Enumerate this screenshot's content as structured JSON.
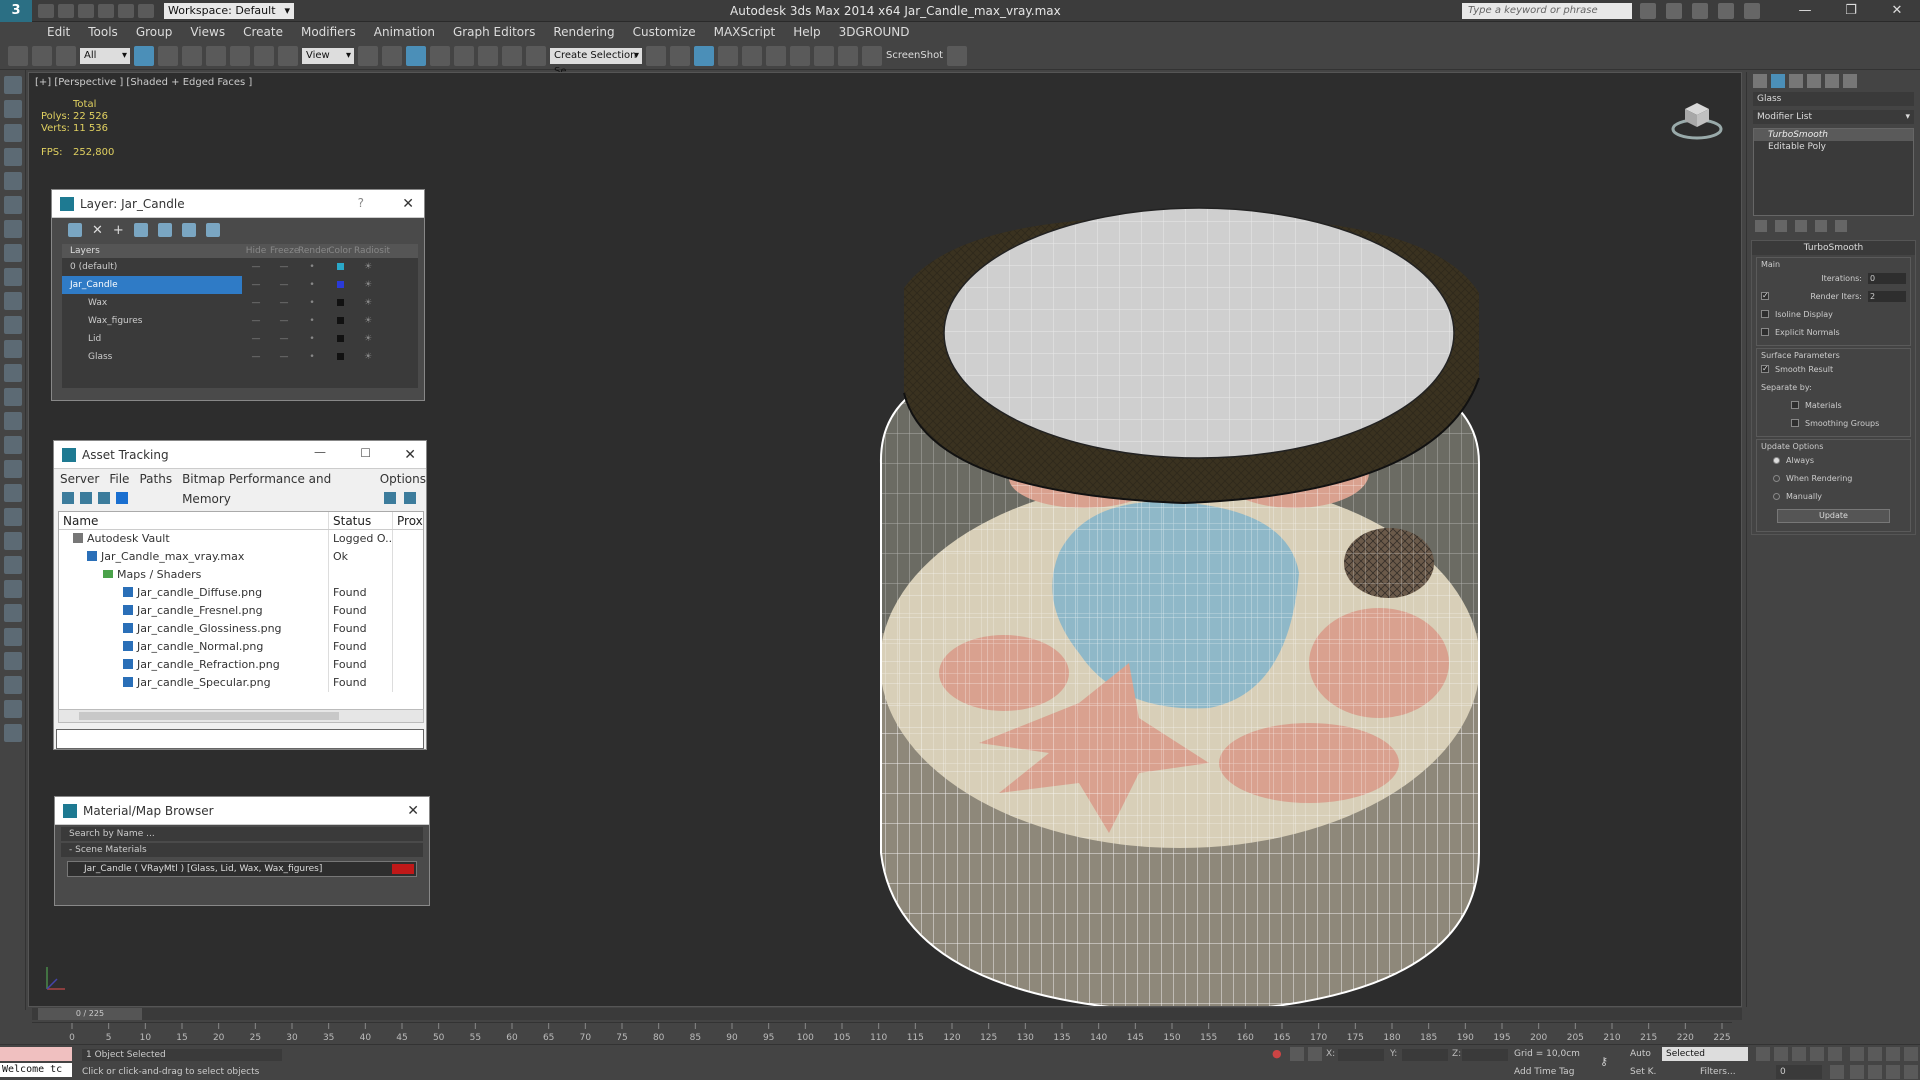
{
  "app": {
    "title": "Autodesk 3ds Max  2014 x64    Jar_Candle_max_vray.max",
    "logo": "3",
    "workspace": "Workspace: Default",
    "search_placeholder": "Type a keyword or phrase"
  },
  "menu": [
    "Edit",
    "Tools",
    "Group",
    "Views",
    "Create",
    "Modifiers",
    "Animation",
    "Graph Editors",
    "Rendering",
    "Customize",
    "MAXScript",
    "Help",
    "3DGROUND"
  ],
  "toolbar": {
    "filter": "All",
    "ref_coord": "View",
    "selection_set": "Create Selection Se",
    "screenshot": "ScreenShot"
  },
  "viewport": {
    "label": "[+] [Perspective ] [Shaded + Edged Faces ]",
    "stats_header": "Total",
    "polys_label": "Polys:",
    "polys": "22 526",
    "verts_label": "Verts:",
    "verts": "11 536",
    "fps_label": "FPS:",
    "fps": "252,800"
  },
  "layer_panel": {
    "title": "Layer: Jar_Candle",
    "help": "?",
    "headers": [
      "Layers",
      "Hide",
      "Freeze",
      "Render",
      "Color",
      "Radiosit"
    ],
    "rows": [
      {
        "name": "0 (default)",
        "color": "#2aa8c8",
        "selected": false
      },
      {
        "name": "Jar_Candle",
        "color": "#2a3ad8",
        "selected": true
      },
      {
        "name": "Wax",
        "color": "#111111",
        "selected": false
      },
      {
        "name": "Wax_figures",
        "color": "#111111",
        "selected": false
      },
      {
        "name": "Lid",
        "color": "#111111",
        "selected": false
      },
      {
        "name": "Glass",
        "color": "#111111",
        "selected": false
      }
    ]
  },
  "asset_panel": {
    "title": "Asset Tracking",
    "menu": [
      "Server",
      "File",
      "Paths",
      "Bitmap Performance and Memory",
      "Options"
    ],
    "headers": [
      "Name",
      "Status",
      "Proxy"
    ],
    "rows": [
      {
        "name": "Autodesk Vault",
        "status": "Logged O..."
      },
      {
        "name": "Jar_Candle_max_vray.max",
        "status": "Ok"
      },
      {
        "name": "Maps / Shaders",
        "status": ""
      },
      {
        "name": "Jar_candle_Diffuse.png",
        "status": "Found"
      },
      {
        "name": "Jar_candle_Fresnel.png",
        "status": "Found"
      },
      {
        "name": "Jar_candle_Glossiness.png",
        "status": "Found"
      },
      {
        "name": "Jar_candle_Normal.png",
        "status": "Found"
      },
      {
        "name": "Jar_candle_Refraction.png",
        "status": "Found"
      },
      {
        "name": "Jar_candle_Specular.png",
        "status": "Found"
      }
    ]
  },
  "material_panel": {
    "title": "Material/Map Browser",
    "search_placeholder": "Search by Name ...",
    "section": "- Scene Materials",
    "item": "Jar_Candle  ( VRayMtl )  [Glass, Lid, Wax, Wax_figures]"
  },
  "command_panel": {
    "object_name": "Glass",
    "modifier_list": "Modifier List",
    "stack": [
      "TurboSmooth",
      "Editable Poly"
    ],
    "rollout_title": "TurboSmooth",
    "main_label": "Main",
    "iterations_label": "Iterations:",
    "iterations": "0",
    "render_iters_label": "Render Iters:",
    "render_iters": "2",
    "isoline": "Isoline Display",
    "explicit_normals": "Explicit Normals",
    "surface_params": "Surface Parameters",
    "smooth_result": "Smooth Result",
    "separate_by": "Separate by:",
    "materials": "Materials",
    "smoothing_groups": "Smoothing Groups",
    "update_options": "Update Options",
    "always": "Always",
    "when_rendering": "When Rendering",
    "manually": "Manually",
    "update_button": "Update"
  },
  "timeline": {
    "slider": "0 / 225",
    "ticks": [
      "0",
      "5",
      "10",
      "15",
      "20",
      "25",
      "30",
      "35",
      "40",
      "45",
      "50",
      "55",
      "60",
      "65",
      "70",
      "75",
      "80",
      "85",
      "90",
      "95",
      "100",
      "105",
      "110",
      "115",
      "120",
      "125",
      "130",
      "135",
      "140",
      "145",
      "150",
      "155",
      "160",
      "165",
      "170",
      "175",
      "180",
      "185",
      "190",
      "195",
      "200",
      "205",
      "210",
      "215",
      "220",
      "225"
    ]
  },
  "status": {
    "maxscript": "Welcome tc",
    "selection": "1 Object Selected",
    "prompt": "Click or click-and-drag to select objects",
    "x_label": "X:",
    "y_label": "Y:",
    "z_label": "Z:",
    "grid": "Grid = 10,0cm",
    "add_time_tag": "Add Time Tag",
    "auto": "Auto",
    "set_k": "Set K.",
    "selected": "Selected",
    "filters": "Filters...",
    "frame": "0"
  },
  "colors": {
    "accent": "#2f7bc6",
    "viewport_bg": "#2d2d2d",
    "stats": "#e0d060",
    "lid_rim": "#3a3220",
    "wax": "#d8cfb8",
    "figures": "#d9a18f",
    "glass_blue": "#8fb8c8"
  }
}
